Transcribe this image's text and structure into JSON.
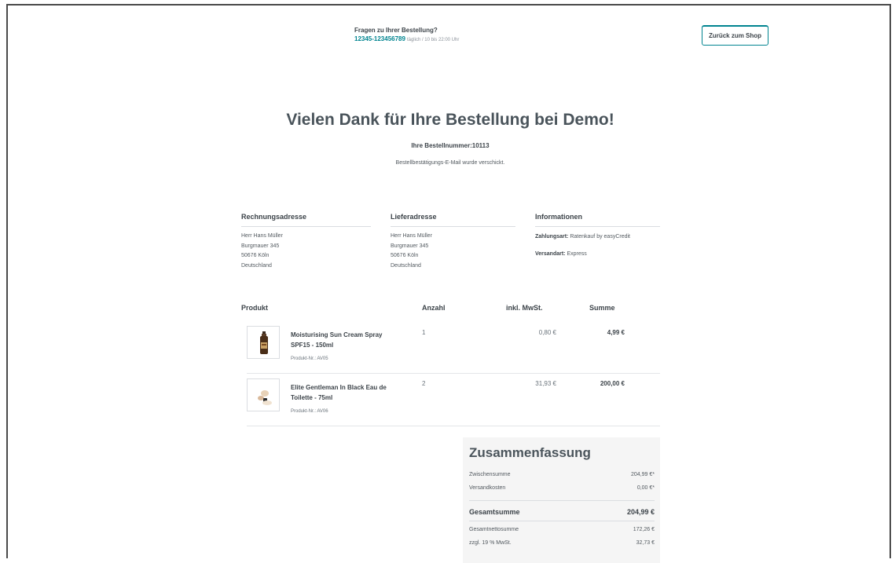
{
  "header": {
    "hotline_question": "Fragen zu Ihrer Bestellung?",
    "hotline_number": "12345-123456789",
    "hotline_hours": "täglich / 10 bis 22:00 Uhr",
    "back_button": "Zurück zum Shop"
  },
  "confirmation": {
    "title": "Vielen Dank für Ihre Bestellung bei Demo!",
    "order_number": "Ihre Bestellnummer:10113",
    "mail_sent": "Bestellbestätigungs-E-Mail wurde verschickt."
  },
  "billing": {
    "heading": "Rechnungsadresse",
    "lines": [
      "Herr Hans Müller",
      "Burgmauer 345",
      "50676 Köln",
      "Deutschland"
    ]
  },
  "shipping": {
    "heading": "Lieferadresse",
    "lines": [
      "Herr Hans Müller",
      "Burgmauer 345",
      "50676 Köln",
      "Deutschland"
    ]
  },
  "information": {
    "heading": "Informationen",
    "payment_label": "Zahlungsart:",
    "payment_value": "Ratenkauf by easyCredit",
    "shipping_label": "Versandart:",
    "shipping_value": "Express"
  },
  "table": {
    "headers": {
      "product": "Produkt",
      "quantity": "Anzahl",
      "tax": "inkl. MwSt.",
      "total": "Summe"
    },
    "rows": [
      {
        "name": "Moisturising Sun Cream Spray SPF15 - 150ml",
        "sku": "Produkt-Nr.: AV05",
        "quantity": "1",
        "tax": "0,80 €",
        "total": "4,99 €",
        "image_icon": "sun-spray-bottle-icon"
      },
      {
        "name": "Elite Gentleman In Black Eau de Toilette - 75ml",
        "sku": "Produkt-Nr.: AV06",
        "quantity": "2",
        "tax": "31,93 €",
        "total": "200,00 €",
        "image_icon": "perfume-icon"
      }
    ]
  },
  "summary": {
    "title": "Zusammenfassung",
    "subtotal_label": "Zwischensumme",
    "subtotal_value": "204,99 €*",
    "shipping_label": "Versandkosten",
    "shipping_value": "0,00 €*",
    "total_label": "Gesamtsumme",
    "total_value": "204,99 €",
    "net_label": "Gesamtnettosumme",
    "net_value": "172,26 €",
    "vat_label": "zzgl. 19 % MwSt.",
    "vat_value": "32,73 €"
  },
  "colors": {
    "accent": "#008490",
    "text": "#4a545b",
    "summary_bg": "#f5f5f5"
  }
}
